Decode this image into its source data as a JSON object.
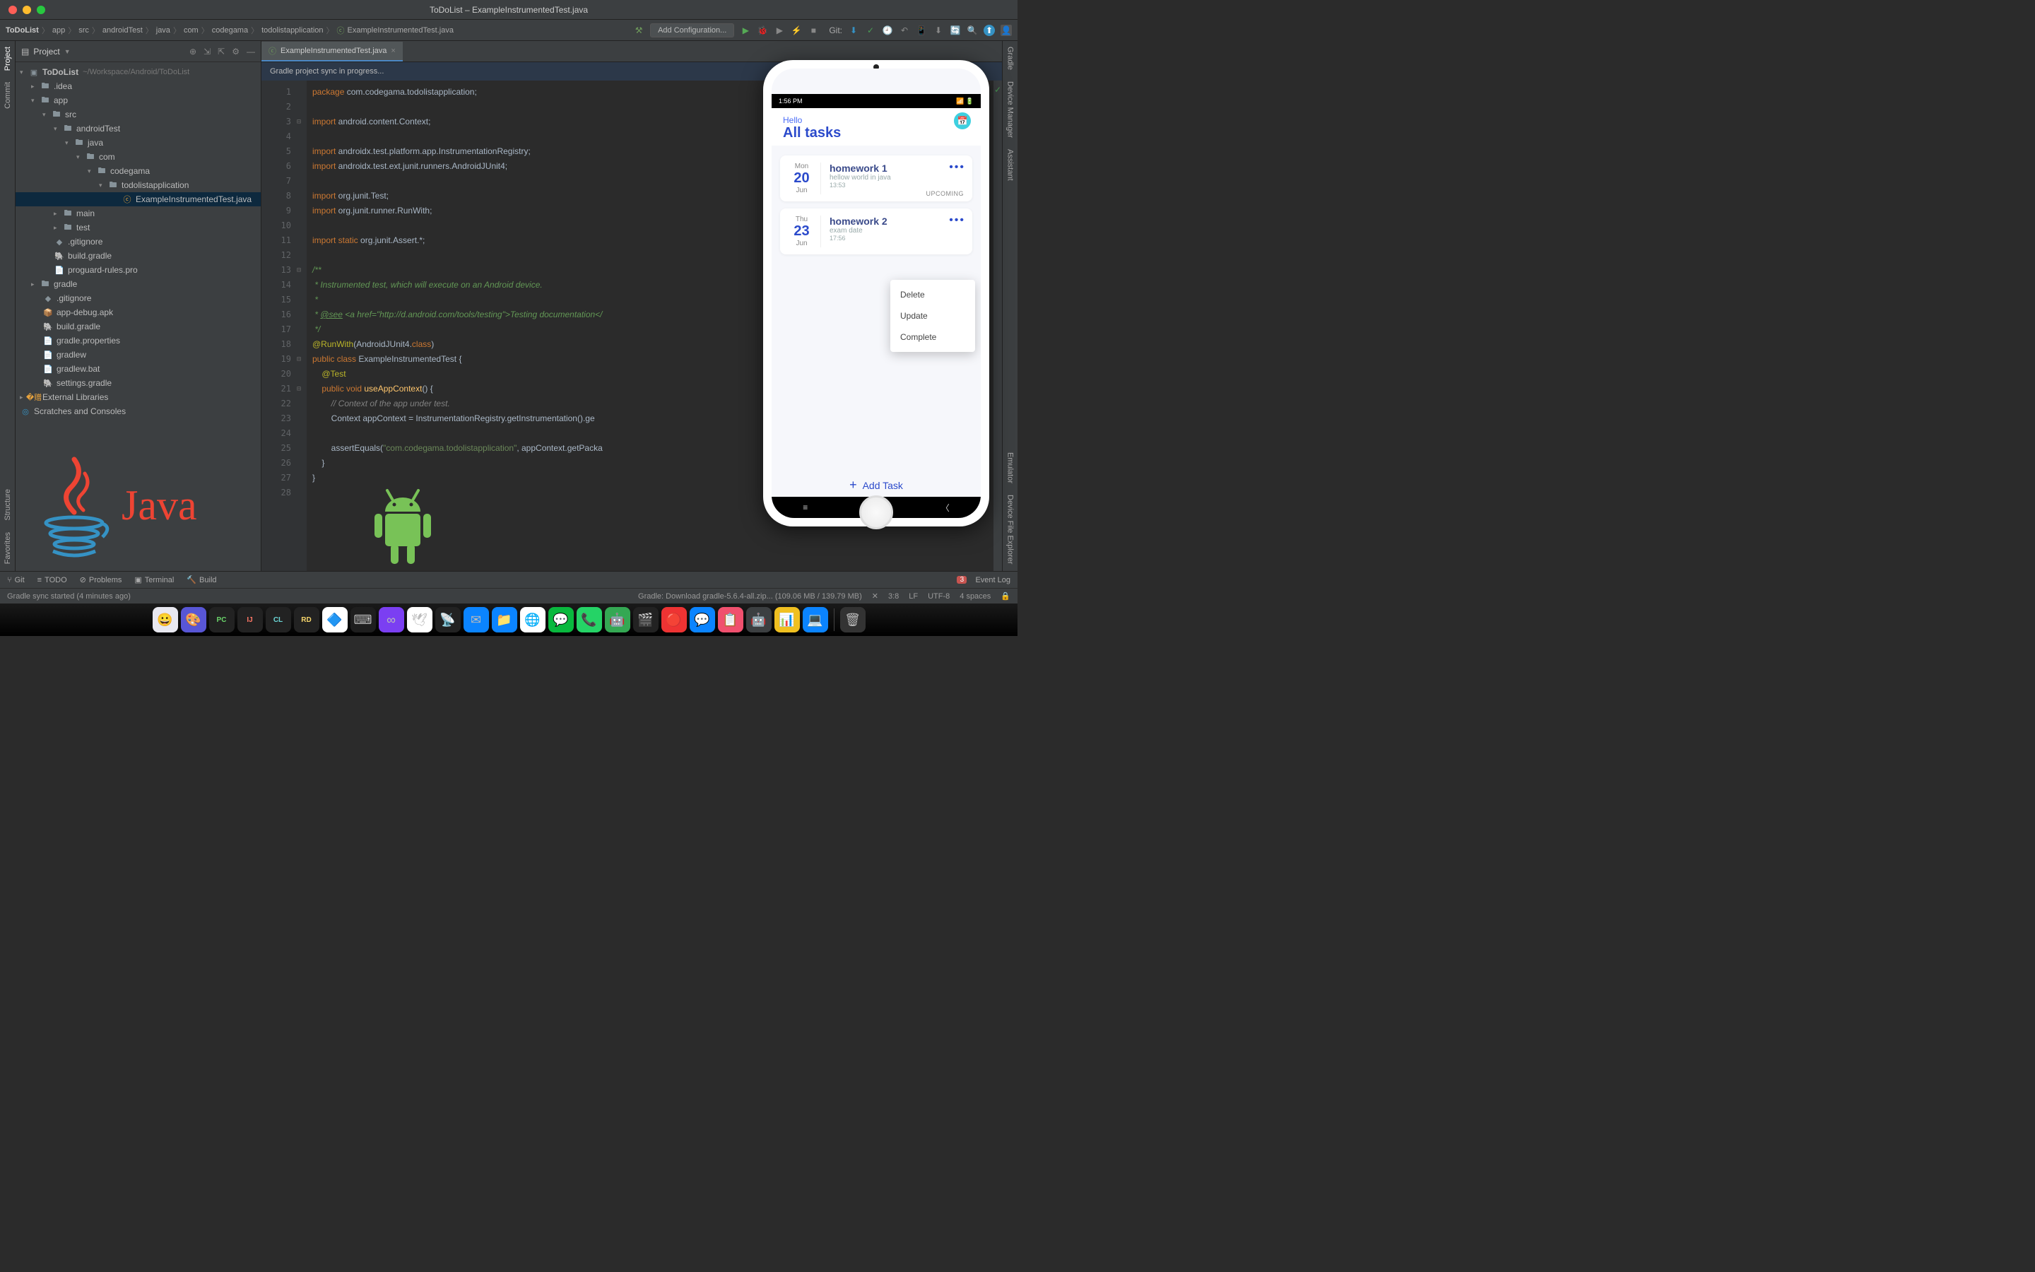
{
  "window": {
    "title": "ToDoList – ExampleInstrumentedTest.java"
  },
  "breadcrumb": [
    "ToDoList",
    "app",
    "src",
    "androidTest",
    "java",
    "com",
    "codegama",
    "todolistapplication",
    "ExampleInstrumentedTest.java"
  ],
  "run_config": {
    "label": "Add Configuration..."
  },
  "git_label": "Git:",
  "project_panel": {
    "title": "Project"
  },
  "tree": {
    "root": "ToDoList",
    "root_path": "~/Workspace/Android/ToDoList",
    "nodes": [
      ".idea",
      "app",
      "src",
      "androidTest",
      "java",
      "com",
      "codegama",
      "todolistapplication",
      "ExampleInstrumentedTest.java",
      "main",
      "test",
      ".gitignore",
      "build.gradle",
      "proguard-rules.pro",
      "gradle",
      ".gitignore",
      "app-debug.apk",
      "build.gradle",
      "gradle.properties",
      "gradlew",
      "gradlew.bat",
      "settings.gradle",
      "External Libraries",
      "Scratches and Consoles"
    ]
  },
  "left_tools": [
    "Project",
    "Commit",
    "Structure",
    "Favorites"
  ],
  "right_tools": [
    "Gradle",
    "Device Manager",
    "Assistant",
    "Emulator",
    "Device File Explorer"
  ],
  "tab": {
    "label": "ExampleInstrumentedTest.java"
  },
  "banner": "Gradle project sync in progress...",
  "code": {
    "lines": 28,
    "l1a": "package",
    "l1b": " com.codegama.todolistapplication;",
    "l3a": "import",
    "l3b": " android.content.Context;",
    "l5a": "import",
    "l5b": " androidx.test.platform.app.InstrumentationRegistry;",
    "l6a": "import",
    "l6b": " androidx.test.ext.junit.runners.AndroidJUnit4;",
    "l8a": "import",
    "l8b": " org.junit.Test;",
    "l9a": "import",
    "l9b": " org.junit.runner.RunWith;",
    "l11a": "import static",
    "l11b": " org.junit.Assert.*;",
    "l13": "/**",
    "l14": " * Instrumented test, which will execute on an Android device.",
    "l15": " *",
    "l16a": " * ",
    "l16b": "@see",
    "l16c": " <a href=\"http://d.android.com/tools/testing\">Testing documentation</",
    "l17": " */",
    "l18a": "@RunWith",
    "l18b": "(AndroidJUnit4.",
    "l18c": "class",
    "l18d": ")",
    "l19a": "public class ",
    "l19b": "ExampleInstrumentedTest",
    " l19c": " {",
    "l20": "    @Test",
    "l21a": "    public void ",
    "l21b": "useAppContext",
    "l21c": "() {",
    "l22": "        // Context of the app under test.",
    "l23": "        Context appContext = InstrumentationRegistry.getInstrumentation().ge",
    "l25a": "        assertEquals(",
    "l25b": "\"com.codegama.todolistapplication\"",
    "l25c": ", appContext.getPacka",
    "l26": "    }",
    "l27": "}"
  },
  "bottom": {
    "git": "Git",
    "todo": "TODO",
    "problems": "Problems",
    "terminal": "Terminal",
    "build": "Build",
    "event_count": "3",
    "event_log": "Event Log"
  },
  "status": {
    "left": "Gradle sync started (4 minutes ago)",
    "download": "Gradle: Download gradle-5.6.4-all.zip...   (109.06 MB / 139.79 MB)",
    "pos": "3:8",
    "lf": "LF",
    "enc": "UTF-8",
    "indent": "4 spaces"
  },
  "phone": {
    "time": "1:56 PM",
    "hello": "Hello",
    "title": "All tasks",
    "tasks": [
      {
        "dow": "Mon",
        "day": "20",
        "mon": "Jun",
        "title": "homework 1",
        "sub": "hellow world in java",
        "time": "13:53",
        "status": "UPCOMING"
      },
      {
        "dow": "Thu",
        "day": "23",
        "mon": "Jun",
        "title": "homework 2",
        "sub": "exam date",
        "time": "17:56",
        "status": ""
      }
    ],
    "menu": [
      "Delete",
      "Update",
      "Complete"
    ],
    "add": "Add Task"
  }
}
